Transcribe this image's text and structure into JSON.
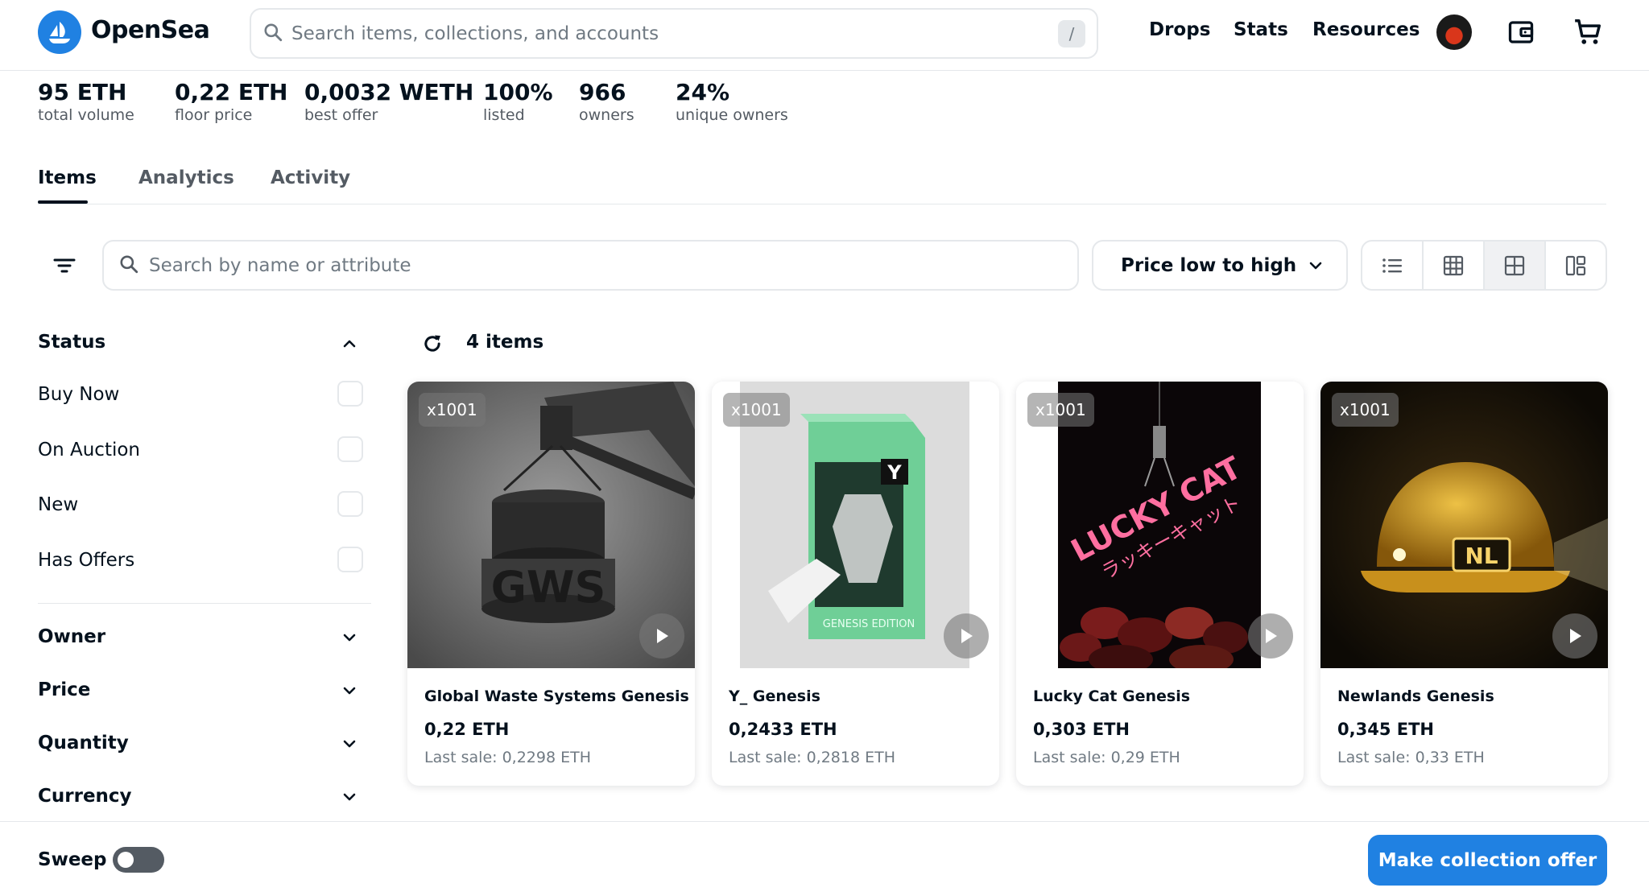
{
  "header": {
    "brand": "OpenSea",
    "search_placeholder": "Search items, collections, and accounts",
    "search_shortcut": "/",
    "nav": [
      "Drops",
      "Stats",
      "Resources"
    ]
  },
  "stats": [
    {
      "value": "95 ETH",
      "label": "total volume"
    },
    {
      "value": "0,22 ETH",
      "label": "floor price"
    },
    {
      "value": "0,0032 WETH",
      "label": "best offer"
    },
    {
      "value": "100%",
      "label": "listed"
    },
    {
      "value": "966",
      "label": "owners"
    },
    {
      "value": "24%",
      "label": "unique owners"
    }
  ],
  "tabs": [
    {
      "label": "Items",
      "active": true
    },
    {
      "label": "Analytics",
      "active": false
    },
    {
      "label": "Activity",
      "active": false
    }
  ],
  "toolbar": {
    "search_placeholder": "Search by name or attribute",
    "sort_label": "Price low to high"
  },
  "sidebar": {
    "status_title": "Status",
    "status_options": [
      "Buy Now",
      "On Auction",
      "New",
      "Has Offers"
    ],
    "sections": [
      "Owner",
      "Price",
      "Quantity",
      "Currency"
    ]
  },
  "results": {
    "count_label": "4 items"
  },
  "items": [
    {
      "name": "Global Waste Systems Genesis",
      "price": "0,22 ETH",
      "last_sale": "Last sale: 0,2298 ETH",
      "quantity": "x1001"
    },
    {
      "name": "Y_ Genesis",
      "price": "0,2433 ETH",
      "last_sale": "Last sale: 0,2818 ETH",
      "quantity": "x1001"
    },
    {
      "name": "Lucky Cat Genesis",
      "price": "0,303 ETH",
      "last_sale": "Last sale: 0,29 ETH",
      "quantity": "x1001"
    },
    {
      "name": "Newlands Genesis",
      "price": "0,345 ETH",
      "last_sale": "Last sale: 0,33 ETH",
      "quantity": "x1001"
    }
  ],
  "artwork_text": {
    "gws": "GWS",
    "y_box": "GENESIS EDITION",
    "lucky_cat": "LUCKY CAT",
    "lucky_cat_jp": "ラッキーキャット"
  },
  "footer": {
    "sweep_label": "Sweep",
    "offer_button": "Make collection offer"
  },
  "colors": {
    "accent": "#2081e2",
    "text": "#04111d",
    "muted": "#707a83",
    "border": "#e5e8eb"
  }
}
